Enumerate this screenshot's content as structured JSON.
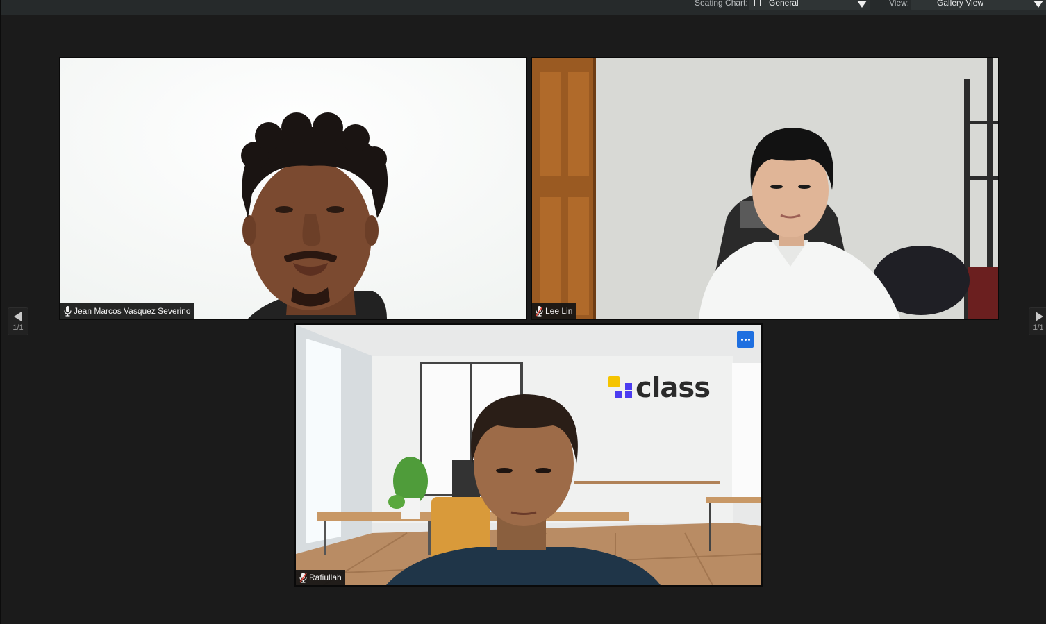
{
  "toolbar": {
    "seating_chart_label": "Seating Chart:",
    "seating_chart_value": "General",
    "view_label": "View:",
    "view_value": "Gallery View"
  },
  "participants": [
    {
      "name": "Jean Marcos Vasquez Severino",
      "mic_icon": "microphone-icon"
    },
    {
      "name": "Lee Lin",
      "mic_icon": "microphone-muted-icon"
    },
    {
      "name": "Rafiullah",
      "mic_icon": "microphone-muted-icon",
      "background_logo_text": "class"
    }
  ],
  "pager": {
    "left_count": "1/1",
    "right_count": "1/1"
  },
  "colors": {
    "more_button": "#1e6fe0",
    "muted_mic": "#e0463b",
    "logo_yellow": "#f5c400",
    "logo_purple": "#4b3cf0"
  }
}
